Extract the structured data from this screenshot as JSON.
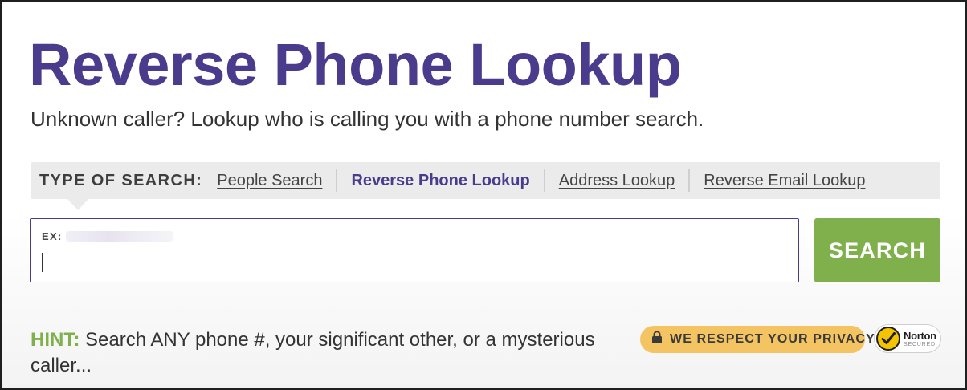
{
  "header": {
    "title": "Reverse Phone Lookup",
    "subtitle": "Unknown caller? Lookup who is calling you with a phone number search."
  },
  "search_type": {
    "label": "TYPE OF SEARCH:",
    "tabs": [
      {
        "label": "People Search",
        "active": false
      },
      {
        "label": "Reverse Phone Lookup",
        "active": true
      },
      {
        "label": "Address Lookup",
        "active": false
      },
      {
        "label": "Reverse Email Lookup",
        "active": false
      }
    ]
  },
  "search": {
    "example_label": "EX:",
    "value": "",
    "button_label": "SEARCH"
  },
  "hint": {
    "label": "HINT:",
    "text": " Search ANY phone #, your significant other, or a mysterious caller..."
  },
  "badges": {
    "privacy": "WE RESPECT YOUR PRIVACY",
    "norton_brand": "Norton",
    "norton_sub": "SECURED"
  },
  "icons": {
    "lock": "lock-icon",
    "norton_check": "norton-checkmark-icon"
  },
  "colors": {
    "brand_purple": "#4a3b8c",
    "accent_green": "#7fb04c",
    "privacy_yellow": "#f4c462"
  }
}
